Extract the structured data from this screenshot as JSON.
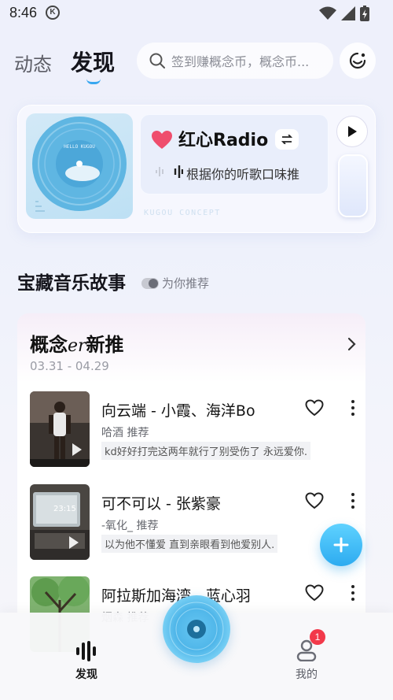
{
  "status_bar": {
    "time": "8:46",
    "k_badge": "K"
  },
  "top_tabs": {
    "dongtai": "动态",
    "faxian": "发现"
  },
  "search": {
    "placeholder": "签到赚概念币，概念币..."
  },
  "radio": {
    "title": "红心Radio",
    "subtitle": "根据你的听歌口味推",
    "concept_text": "KUGOU CONCEPT",
    "disc_text": "HELLO KUGOU"
  },
  "section": {
    "title": "宝藏音乐故事",
    "toggle_label": "为你推荐"
  },
  "list": {
    "title_pre": "概念",
    "title_er": "er",
    "title_post": "新推",
    "date_range": "03.31 - 04.29",
    "songs": [
      {
        "title": "向云端 - 小霞、海洋Bo",
        "recommender": "哈酒 推荐",
        "quote": "kd好好打完这两年就行了别受伤了 永远爱你."
      },
      {
        "title": "可不可以 - 张紫豪",
        "recommender": "-氧化_ 推荐",
        "quote": "以为他不懂爱 直到亲眼看到他爱别人.",
        "cover_time": "23:15"
      },
      {
        "title": "阿拉斯加海湾 - 蓝心羽",
        "recommender": "烟森 推荐",
        "quote": ""
      }
    ]
  },
  "bottom_nav": {
    "faxian": "发现",
    "wode": "我的",
    "badge": "1"
  },
  "colors": {
    "accent_blue": "#2dabf0",
    "heart_red": "#f2394a",
    "badge_red": "#f2394a"
  }
}
